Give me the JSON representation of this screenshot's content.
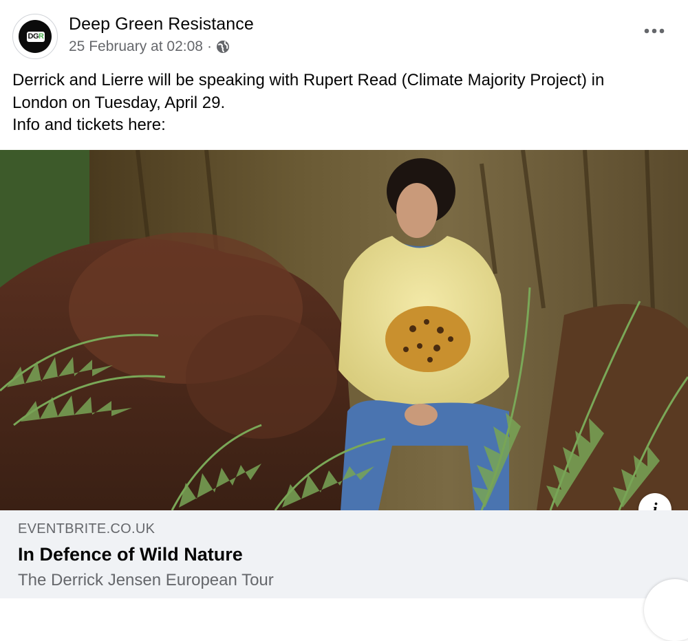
{
  "post": {
    "page_name": "Deep Green Resistance",
    "avatar_text": "DGR",
    "timestamp": "25 February at 02:08",
    "separator": "·",
    "privacy_icon": "globe-icon",
    "more_icon": "more-dots-icon",
    "text_lines": [
      "Derrick and Lierre will be speaking with Rupert Read (Climate Majority Project) in",
      "London on Tuesday, April 29.",
      "Info and tickets here:"
    ]
  },
  "link_preview": {
    "image_alt": "Man in a yellow leopard sweater sitting among ferns at the base of a giant redwood tree",
    "domain": "EVENTBRITE.CO.UK",
    "title": "In Defence of Wild Nature",
    "subtitle": "The Derrick Jensen European Tour",
    "info_icon": "info-icon"
  },
  "colors": {
    "text_primary": "#050505",
    "text_secondary": "#65676b",
    "card_background": "#f0f2f5"
  }
}
